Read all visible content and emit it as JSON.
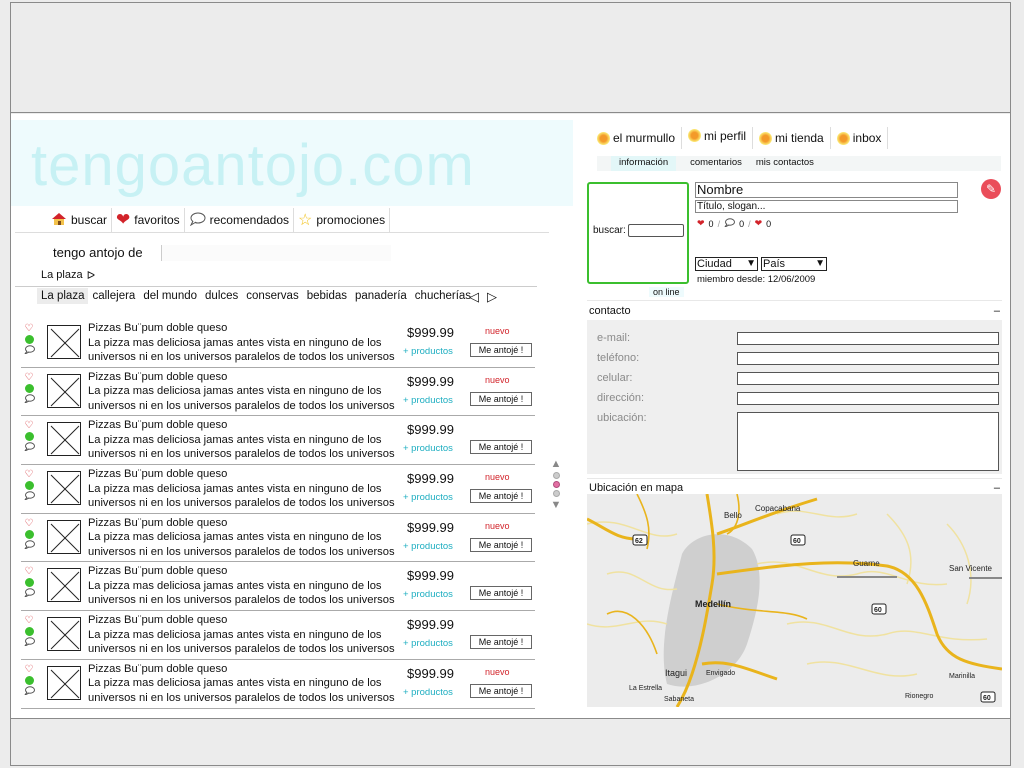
{
  "logo": "tengoantojo.com",
  "main_nav": [
    {
      "label": "buscar",
      "icon": "house-icon"
    },
    {
      "label": "favoritos",
      "icon": "heart-icon"
    },
    {
      "label": "recomendados",
      "icon": "speech-bubble-icon"
    },
    {
      "label": "promociones",
      "icon": "star-icon"
    }
  ],
  "antojo_label": "tengo antojo de",
  "plaza": {
    "label": "La plaza",
    "arrow": "ᐅ"
  },
  "categories": [
    "La plaza",
    "callejera",
    "del mundo",
    "dulces",
    "conservas",
    "bebidas",
    "panadería",
    "chucherías"
  ],
  "cat_arrows": {
    "prev": "◁",
    "next": "▷"
  },
  "products": [
    {
      "title": "Pizzas Bu¨pum doble queso",
      "line1": "La pizza mas deliciosa jamas antes vista en ninguno de los",
      "line2": "universos ni en los universos paralelos de todos los universos",
      "price": "$999.99",
      "more": "+ productos",
      "badge": "nuevo",
      "button": "Me antojé !"
    },
    {
      "title": "Pizzas Bu¨pum doble queso",
      "line1": "La pizza mas deliciosa jamas antes vista en ninguno de los",
      "line2": "universos ni en los universos paralelos de todos los universos",
      "price": "$999.99",
      "more": "+ productos",
      "badge": "nuevo",
      "button": "Me antojé !"
    },
    {
      "title": "Pizzas Bu¨pum doble queso",
      "line1": "La pizza mas deliciosa jamas antes vista en ninguno de los",
      "line2": "universos ni en los universos paralelos de todos los universos",
      "price": "$999.99",
      "more": "+ productos",
      "badge": "",
      "button": "Me antojé !"
    },
    {
      "title": "Pizzas Bu¨pum doble queso",
      "line1": "La pizza mas deliciosa jamas antes vista en ninguno de los",
      "line2": "universos ni en los universos paralelos de todos los universos",
      "price": "$999.99",
      "more": "+ productos",
      "badge": "nuevo",
      "button": "Me antojé !"
    },
    {
      "title": "Pizzas Bu¨pum doble queso",
      "line1": "La pizza mas deliciosa jamas antes vista en ninguno de los",
      "line2": "universos ni en los universos paralelos de todos los universos",
      "price": "$999.99",
      "more": "+ productos",
      "badge": "nuevo",
      "button": "Me antojé !"
    },
    {
      "title": "Pizzas Bu¨pum doble queso",
      "line1": "La pizza mas deliciosa jamas antes vista en ninguno de los",
      "line2": "universos ni en los universos paralelos de todos los universos",
      "price": "$999.99",
      "more": "+ productos",
      "badge": "",
      "button": "Me antojé !"
    },
    {
      "title": "Pizzas Bu¨pum doble queso",
      "line1": "La pizza mas deliciosa jamas antes vista en ninguno de los",
      "line2": "universos ni en los universos paralelos de todos los universos",
      "price": "$999.99",
      "more": "+ productos",
      "badge": "",
      "button": "Me antojé !"
    },
    {
      "title": "Pizzas Bu¨pum doble queso",
      "line1": "La pizza mas deliciosa jamas antes vista en ninguno de los",
      "line2": "universos ni en los universos paralelos de todos los universos",
      "price": "$999.99",
      "more": "+ productos",
      "badge": "nuevo",
      "button": "Me antojé !"
    }
  ],
  "right_nav": [
    "el murmullo",
    "mi perfil",
    "mi tienda",
    "inbox"
  ],
  "sub_tabs": [
    "información",
    "comentarios",
    "mis contactos"
  ],
  "profile": {
    "buscar_label": "buscar:",
    "online": "on line",
    "name": "Nombre",
    "slogan": "Título, slogan...",
    "stats": {
      "hearts": "0",
      "comments": "0",
      "loves": "0"
    },
    "city": "Ciudad",
    "country": "País",
    "member_since": "miembro desde: 12/06/2009"
  },
  "contact": {
    "title": "contacto",
    "collapse": "–",
    "fields": [
      "e-mail:",
      "teléfono:",
      "celular:",
      "dirección:",
      "ubicación:"
    ]
  },
  "map": {
    "title": "Ubicación en mapa",
    "collapse": "–",
    "places": [
      "Bello",
      "Copacabana",
      "Medellín",
      "Guarne",
      "San Vicente",
      "Itagui",
      "Envigado",
      "La Estrella",
      "Sabaneta",
      "Marinilla",
      "Rionegro"
    ],
    "shields": [
      "62",
      "60",
      "60",
      "60"
    ]
  },
  "colors": {
    "accent_cyan": "#1eaec1",
    "logo": "#c7f1f4",
    "heart": "#d2232a",
    "online_green": "#3bbf2e"
  }
}
